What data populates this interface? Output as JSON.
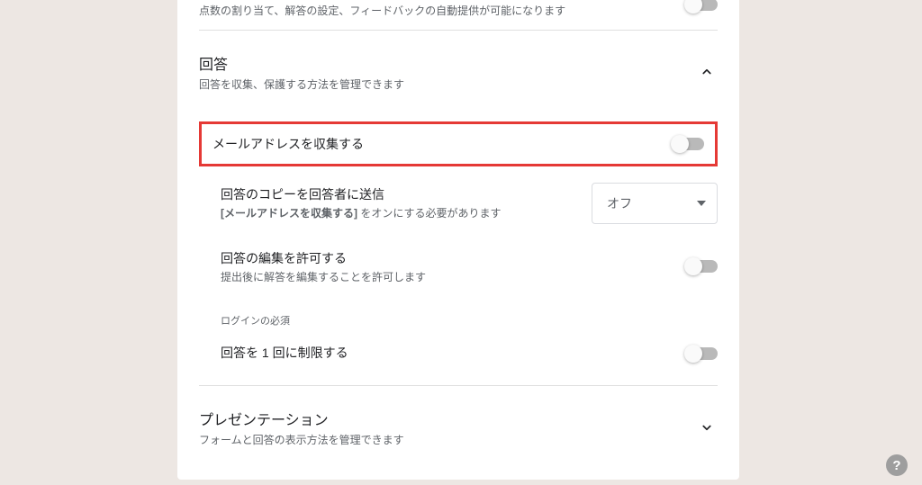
{
  "top": {
    "desc": "点数の割り当て、解答の設定、フィードバックの自動提供が可能になります"
  },
  "responses": {
    "title": "回答",
    "desc": "回答を収集、保護する方法を管理できます",
    "collect_email": {
      "label": "メールアドレスを収集する"
    },
    "send_copy": {
      "label": "回答のコピーを回答者に送信",
      "sub_bold": "[メールアドレスを収集する]",
      "sub_rest": " をオンにする必要があります",
      "dropdown_value": "オフ"
    },
    "allow_edit": {
      "label": "回答の編集を許可する",
      "sub": "提出後に解答を編集することを許可します"
    },
    "login_heading": "ログインの必須",
    "limit_one": {
      "label": "回答を 1 回に制限する"
    }
  },
  "presentation": {
    "title": "プレゼンテーション",
    "desc": "フォームと回答の表示方法を管理できます"
  }
}
